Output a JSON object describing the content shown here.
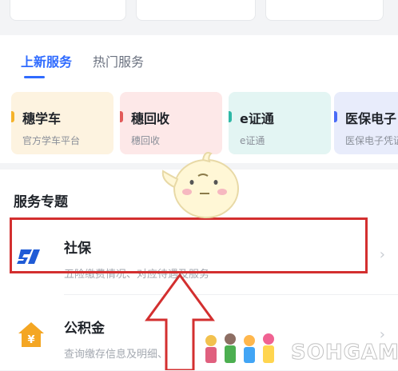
{
  "top_buttons": [
    "",
    "",
    ""
  ],
  "tabs": [
    {
      "label": "上新服务",
      "active": true
    },
    {
      "label": "热门服务",
      "active": false
    }
  ],
  "tiles": [
    {
      "title": "穗学车",
      "subtitle": "官方学车平台",
      "accent": "#f5b32a"
    },
    {
      "title": "穗回收",
      "subtitle": "穗回收",
      "accent": "#e25a5a"
    },
    {
      "title": "e证通",
      "subtitle": "e证通",
      "accent": "#2fb8a6"
    },
    {
      "title": "医保电子",
      "subtitle": "医保电子凭证",
      "accent": "#4a6cf7"
    }
  ],
  "services": {
    "section_title": "服务专题",
    "items": [
      {
        "name": "社保",
        "description": "五险缴费情况、对应待遇及服务",
        "icon": "social-security-icon"
      },
      {
        "name": "公积金",
        "description": "查询缴存信息及明细、提取",
        "icon": "housing-fund-icon"
      }
    ]
  },
  "watermark": {
    "text": "SOHGAME"
  },
  "colors": {
    "primary": "#2f6bff",
    "highlight": "#d32f2f"
  }
}
